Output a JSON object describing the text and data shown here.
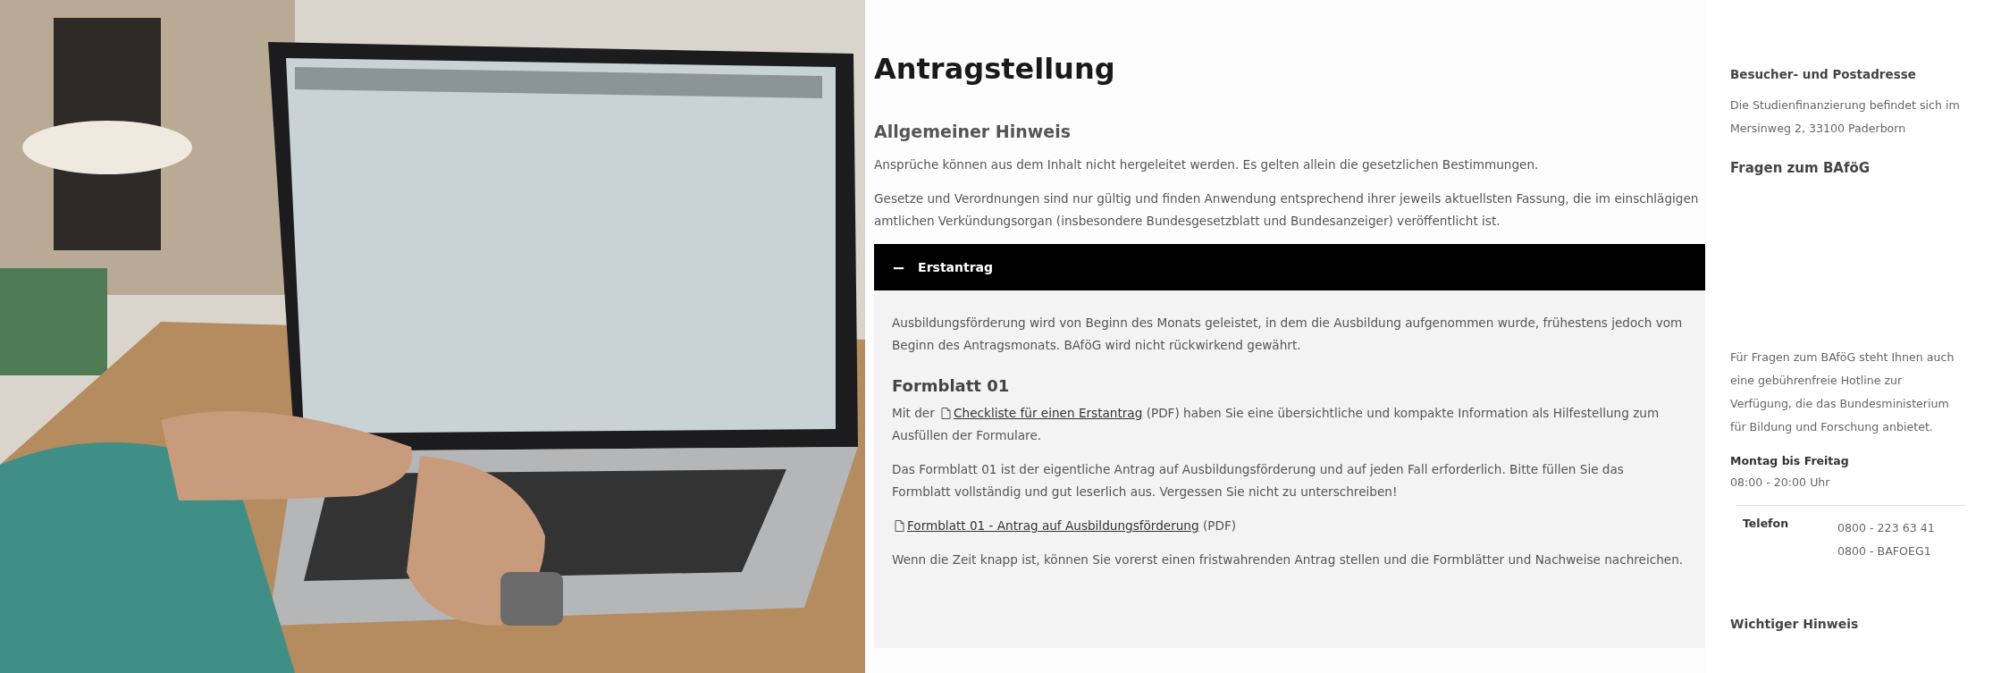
{
  "title": "Antragstellung",
  "notice": {
    "heading": "Allgemeiner Hinweis",
    "paragraphs": [
      "Ansprüche können aus dem Inhalt nicht hergeleitet werden. Es gelten allein die gesetzlichen Bestimmungen.",
      "Gesetze und Verordnungen sind nur gültig und finden Anwendung entsprechend ihrer jeweils aktuellsten Fassung, die im einschlägigen amtlichen Verkündungsorgan (insbesondere Bundesgesetzblatt und Bundesanzeiger) veröffentlicht ist."
    ]
  },
  "accordion": {
    "toggle": "−",
    "label": "Erstantrag",
    "expanded": true,
    "blocks": [
      {
        "kind": "text",
        "text": "Ausbildungsförderung wird von Beginn des Monats geleistet, in dem die Ausbildung aufgenommen wurde, frühestens jedoch vom Beginn des Antragsmonats. BAföG wird nicht rückwirkend gewährt."
      },
      {
        "kind": "heading",
        "text": "Formblatt 01"
      },
      {
        "kind": "link",
        "before": "Mit der",
        "link": "Checkliste für einen Erstantrag",
        "after": "(PDF) haben Sie eine übersichtliche und kompakte Information als Hilfestellung zum Ausfüllen der Formulare."
      },
      {
        "kind": "text",
        "text": "Das Formblatt 01 ist der eigentliche Antrag auf Ausbildungsförderung und auf jeden Fall erforderlich. Bitte füllen Sie das Formblatt vollständig und gut leserlich aus. Vergessen Sie nicht zu unterschreiben!"
      },
      {
        "kind": "link",
        "link": "Formblatt 01 - Antrag auf Ausbildungsförderung",
        "after": "(PDF)"
      },
      {
        "kind": "text",
        "text": "Wenn die Zeit knapp ist, können Sie vorerst einen fristwahrenden Antrag stellen und die Formblätter und Nachweise nachreichen."
      }
    ]
  },
  "sidebar": {
    "address": {
      "heading": "Besucher- und Postadresse",
      "text": "Die Studienfinanzierung befindet sich im Mersinweg 2, 33100 Paderborn"
    },
    "questions": {
      "heading": "Fragen zum BAföG",
      "text": "Für Fragen zum BAföG steht Ihnen auch eine gebührenfreie Hotline zur Verfügung, die das Bundesministerium für Bildung und Forschung anbietet.",
      "hours_label": "Montag bis Freitag",
      "hours": "08:00 - 20:00 Uhr",
      "phone_label": "Telefon",
      "phones": [
        "0800 - 223 63 41",
        "0800 - BAFOEG1"
      ]
    },
    "notice_heading": "Wichtiger Hinweis"
  }
}
